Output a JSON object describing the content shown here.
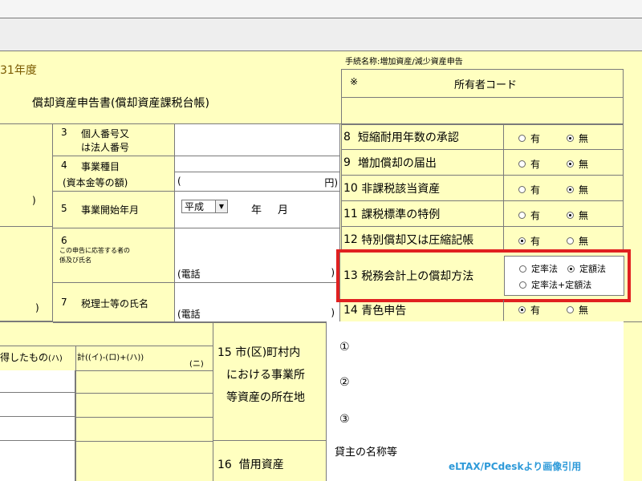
{
  "year_label": "31年度",
  "form_title": "償却資産申告書(償却資産課税台帳)",
  "procedure_name": "手続名称:増加資産/減少資産申告",
  "owner_code": {
    "mark": "※",
    "label": "所有者コード"
  },
  "left_rows": [
    {
      "num": "3",
      "label_line1": "個人番号又",
      "label_line2": "は法人番号"
    },
    {
      "num": "4",
      "label_line1": "事業種目",
      "label_line2": "(資本金等の額)",
      "open_paren": "(",
      "unit": "円)"
    },
    {
      "num": "5",
      "label": "事業開始年月",
      "era": "平成",
      "year_unit": "年",
      "month_unit": "月"
    },
    {
      "num": "6",
      "label_line1": "この申告に応答する者の",
      "label_line2": "係及び氏名",
      "phone": "(電話",
      "close": ")"
    },
    {
      "num": "7",
      "label": "税理士等の氏名",
      "phone": "(電話",
      "close": ")"
    }
  ],
  "left_parens": [
    ")",
    ")"
  ],
  "right_rows": [
    {
      "num": "8",
      "label": "短縮耐用年数の承認",
      "opt1": "有",
      "opt2": "無",
      "selected": 2
    },
    {
      "num": "9",
      "label": "増加償却の届出",
      "opt1": "有",
      "opt2": "無",
      "selected": 2
    },
    {
      "num": "10",
      "label": "非課税該当資産",
      "opt1": "有",
      "opt2": "無",
      "selected": 2
    },
    {
      "num": "11",
      "label": "課税標準の特例",
      "opt1": "有",
      "opt2": "無",
      "selected": 2
    },
    {
      "num": "12",
      "label": "特別償却又は圧縮記帳",
      "opt1": "有",
      "opt2": "無",
      "selected": 1
    },
    {
      "num": "14",
      "label": "青色申告",
      "opt1": "有",
      "opt2": "無",
      "selected": 1
    }
  ],
  "row13": {
    "num": "13",
    "label": "税務会計上の償却方法",
    "opt1": "定率法",
    "opt2": "定額法",
    "opt3": "定率法+定額法",
    "selected": 2
  },
  "row15": {
    "num": "15",
    "line1": "市(区)町村内",
    "line2": "における事業所",
    "line3": "等資産の所在地",
    "items": [
      "①",
      "②",
      "③"
    ]
  },
  "row16": {
    "num": "16",
    "label": "借用資産",
    "lessor_label": "貸主の名称等"
  },
  "bottom_headers": {
    "col_h": "得したもの",
    "col_h_mark": "(ハ)",
    "col_n": "計((イ)-(ロ)+(ハ))",
    "col_n_mark": "(ニ)"
  },
  "credit": "eLTAX/PCdeskより画像引用",
  "colors": {
    "form_yellow": "#ffffc0",
    "highlight_red": "#e02020",
    "credit_blue": "#2e9ad9",
    "year_label_color": "#7a5a00"
  }
}
